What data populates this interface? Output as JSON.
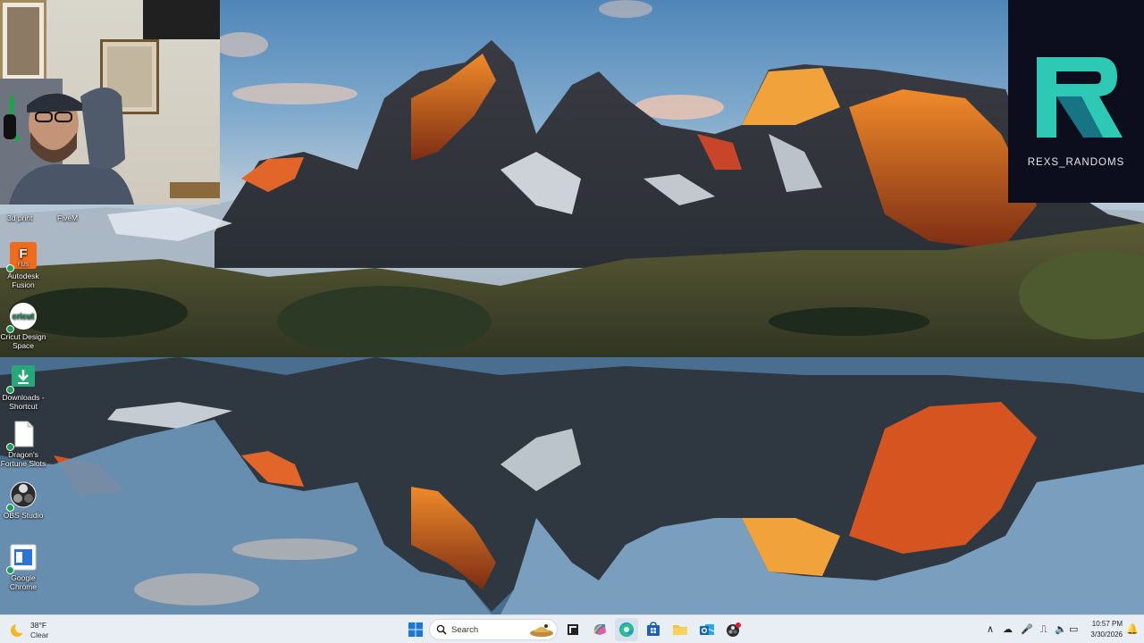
{
  "overlay": {
    "channel_name": "REXS_RANDOMS"
  },
  "desktop_icons": [
    {
      "label_line1": "3d print",
      "label_line2": ""
    },
    {
      "label_line1": "FiveM",
      "label_line2": ""
    },
    {
      "label_line1": "Autodesk",
      "label_line2": "Fusion",
      "badge": "FUS"
    },
    {
      "label_line1": "Cricut Design",
      "label_line2": "Space",
      "badge": "cricut"
    },
    {
      "label_line1": "Downloads -",
      "label_line2": "Shortcut"
    },
    {
      "label_line1": "Dragon's",
      "label_line2": "Fortune Slots"
    },
    {
      "label_line1": "OBS Studio",
      "label_line2": ""
    },
    {
      "label_line1": "Google",
      "label_line2": "Chrome"
    }
  ],
  "taskbar": {
    "weather": {
      "temperature": "38°F",
      "condition": "Clear"
    },
    "search_placeholder": "Search",
    "clock": {
      "time": "10:57 PM",
      "date": "3/30/2026"
    }
  },
  "colors": {
    "taskbar_bg": "#e8eef4",
    "logo_bg": "#0c0e1e",
    "logo_accent": "#2ec9b4"
  }
}
